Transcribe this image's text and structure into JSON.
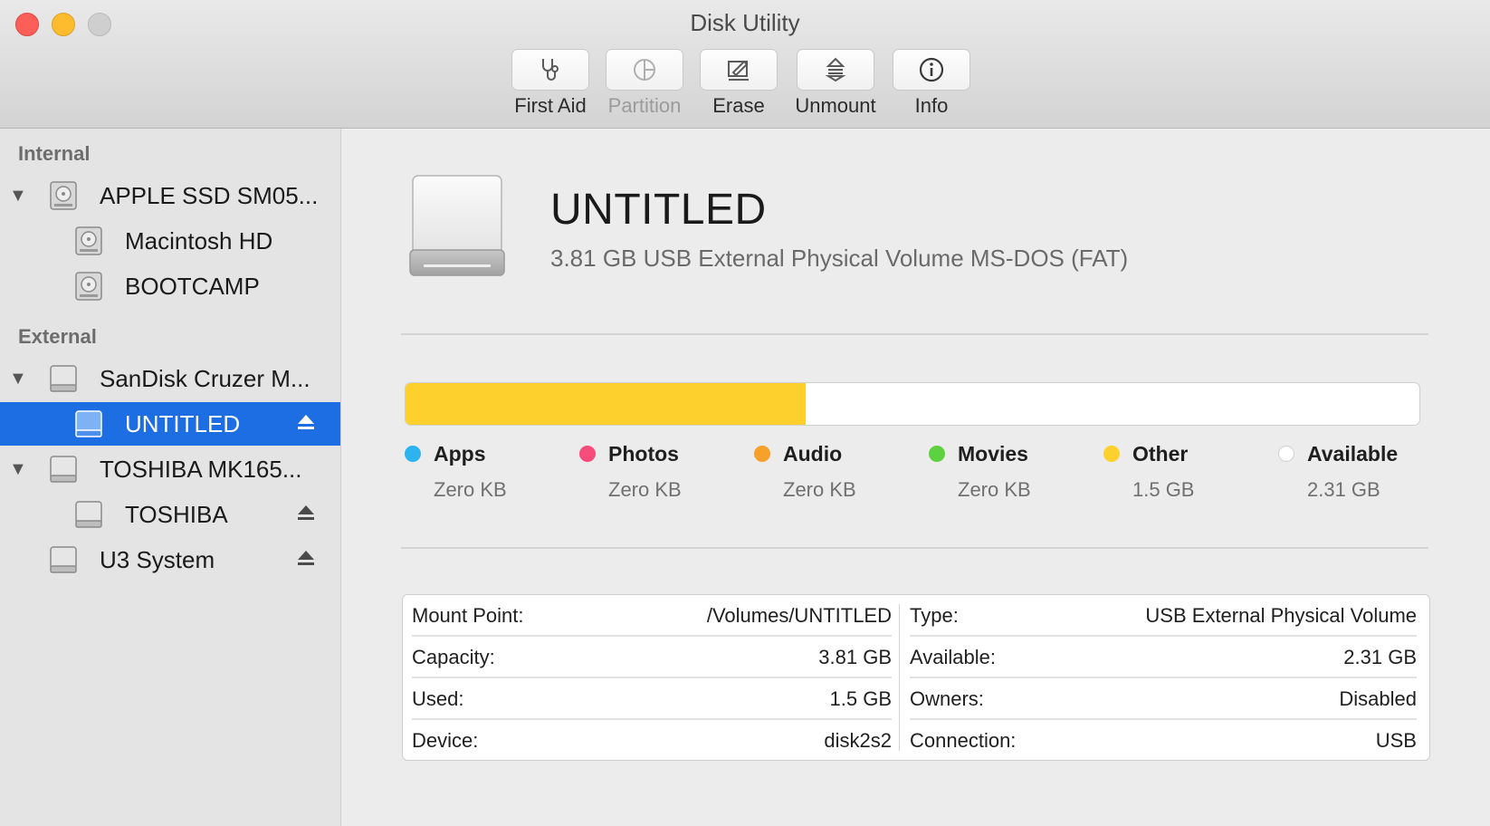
{
  "window": {
    "title": "Disk Utility"
  },
  "toolbar": {
    "items": [
      {
        "label": "First Aid",
        "icon": "stethoscope-icon",
        "enabled": true
      },
      {
        "label": "Partition",
        "icon": "partition-pie-icon",
        "enabled": false
      },
      {
        "label": "Erase",
        "icon": "erase-pencil-icon",
        "enabled": true
      },
      {
        "label": "Unmount",
        "icon": "unmount-icon",
        "enabled": true
      },
      {
        "label": "Info",
        "icon": "info-icon",
        "enabled": true
      }
    ]
  },
  "sidebar": {
    "sections": [
      {
        "title": "Internal"
      },
      {
        "title": "External"
      }
    ],
    "items": [
      {
        "label": "APPLE SSD SM05...",
        "kind": "internal-disk",
        "expanded": true
      },
      {
        "label": "Macintosh HD",
        "kind": "internal-volume"
      },
      {
        "label": "BOOTCAMP",
        "kind": "internal-volume"
      },
      {
        "label": "SanDisk Cruzer M...",
        "kind": "external-disk",
        "expanded": true
      },
      {
        "label": "UNTITLED",
        "kind": "external-volume",
        "selected": true,
        "ejectable": true
      },
      {
        "label": "TOSHIBA MK165...",
        "kind": "external-disk",
        "expanded": true
      },
      {
        "label": "TOSHIBA",
        "kind": "external-volume",
        "ejectable": true
      },
      {
        "label": "U3 System",
        "kind": "external-disk",
        "ejectable": true
      }
    ]
  },
  "volume": {
    "name": "UNTITLED",
    "description": "3.81 GB USB External Physical Volume MS-DOS (FAT)"
  },
  "usage": {
    "used_fraction": 0.395,
    "used_color": "#fdd02d",
    "legend": [
      {
        "name": "Apps",
        "value": "Zero KB",
        "color": "#2cb3f0"
      },
      {
        "name": "Photos",
        "value": "Zero KB",
        "color": "#f84d7a"
      },
      {
        "name": "Audio",
        "value": "Zero KB",
        "color": "#f7a02a"
      },
      {
        "name": "Movies",
        "value": "Zero KB",
        "color": "#5dd140"
      },
      {
        "name": "Other",
        "value": "1.5 GB",
        "color": "#fdd02d"
      },
      {
        "name": "Available",
        "value": "2.31 GB",
        "color": "#ffffff"
      }
    ]
  },
  "details": {
    "left": [
      {
        "key": "Mount Point:",
        "value": "/Volumes/UNTITLED"
      },
      {
        "key": "Capacity:",
        "value": "3.81 GB"
      },
      {
        "key": "Used:",
        "value": "1.5 GB"
      },
      {
        "key": "Device:",
        "value": "disk2s2"
      }
    ],
    "right": [
      {
        "key": "Type:",
        "value": "USB External Physical Volume"
      },
      {
        "key": "Available:",
        "value": "2.31 GB"
      },
      {
        "key": "Owners:",
        "value": "Disabled"
      },
      {
        "key": "Connection:",
        "value": "USB"
      }
    ]
  }
}
